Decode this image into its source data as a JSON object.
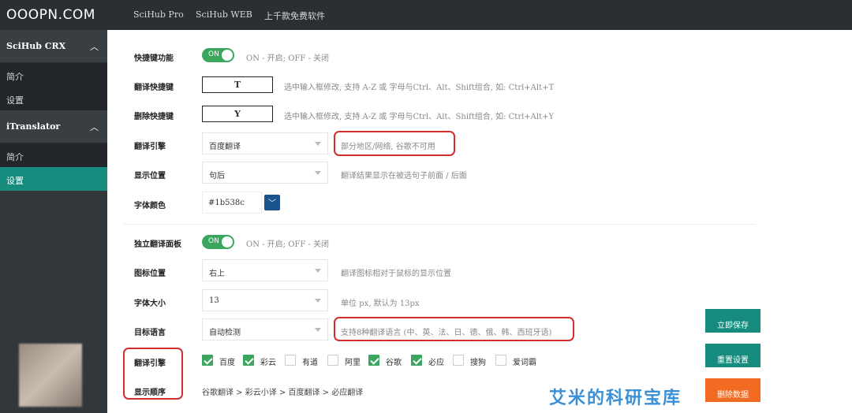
{
  "app": {
    "logo": "OOOPN.COM"
  },
  "topnav": [
    "SciHub Pro",
    "SciHub WEB",
    "上千款免费软件"
  ],
  "sidebar": {
    "groups": [
      {
        "label": "SciHub CRX",
        "items": [
          "简介",
          "设置"
        ]
      },
      {
        "label": "iTranslator",
        "items": [
          "简介",
          "设置"
        ]
      }
    ],
    "chevron": "︿"
  },
  "settings": {
    "hotkey": {
      "label": "快捷键功能",
      "toggle": "ON",
      "hint": "ON - 开启; OFF - 关闭"
    },
    "translate_key": {
      "label": "翻译快捷键",
      "value": "T",
      "hint": "选中输入框修改, 支持 A-Z 或 字母与Ctrl、Alt、Shift组合, 如: Ctrl+Alt+T"
    },
    "delete_key": {
      "label": "删除快捷键",
      "value": "Y",
      "hint": "选中输入框修改, 支持 A-Z 或 字母与Ctrl、Alt、Shift组合, 如: Ctrl+Alt+Y"
    },
    "engine": {
      "label": "翻译引擎",
      "value": "百度翻译",
      "hint": "部分地区/网络, 谷歌不可用"
    },
    "position": {
      "label": "显示位置",
      "value": "句后",
      "hint": "翻译结果显示在被选句子前面 / 后面"
    },
    "font_color": {
      "label": "字体颜色",
      "value": "#1b538c",
      "chevron": "﹀"
    },
    "panel": {
      "label": "独立翻译面板",
      "toggle": "ON",
      "hint": "ON - 开启; OFF - 关闭"
    },
    "icon_pos": {
      "label": "图标位置",
      "value": "右上",
      "hint": "翻译图标相对于鼠标的显示位置"
    },
    "font_size": {
      "label": "字体大小",
      "value": "13",
      "hint": "单位 px, 默认为 13px"
    },
    "target_lang": {
      "label": "目标语言",
      "value": "自动检测",
      "hint": "支持8种翻译语言 (中、英、法、日、德、俄、韩、西班牙语)"
    },
    "engines": {
      "label": "翻译引擎",
      "options": [
        {
          "label": "百度",
          "checked": true
        },
        {
          "label": "彩云",
          "checked": true
        },
        {
          "label": "有道",
          "checked": false
        },
        {
          "label": "阿里",
          "checked": false
        },
        {
          "label": "谷歌",
          "checked": true
        },
        {
          "label": "必应",
          "checked": true
        },
        {
          "label": "搜狗",
          "checked": false
        },
        {
          "label": "爱词霸",
          "checked": false
        }
      ]
    },
    "order": {
      "label": "显示顺序",
      "value": "谷歌翻译 > 彩云小译 > 百度翻译 > 必应翻译"
    }
  },
  "buttons": {
    "save": "立即保存",
    "reset": "重置设置",
    "delete": "删除数据"
  },
  "watermark": "艾米的科研宝库",
  "colors": {
    "accent": "#3aa65e",
    "teal": "#158c7e",
    "orange": "#f36b22",
    "highlight": "#d32f2f",
    "topbar": "#2b2f33"
  }
}
